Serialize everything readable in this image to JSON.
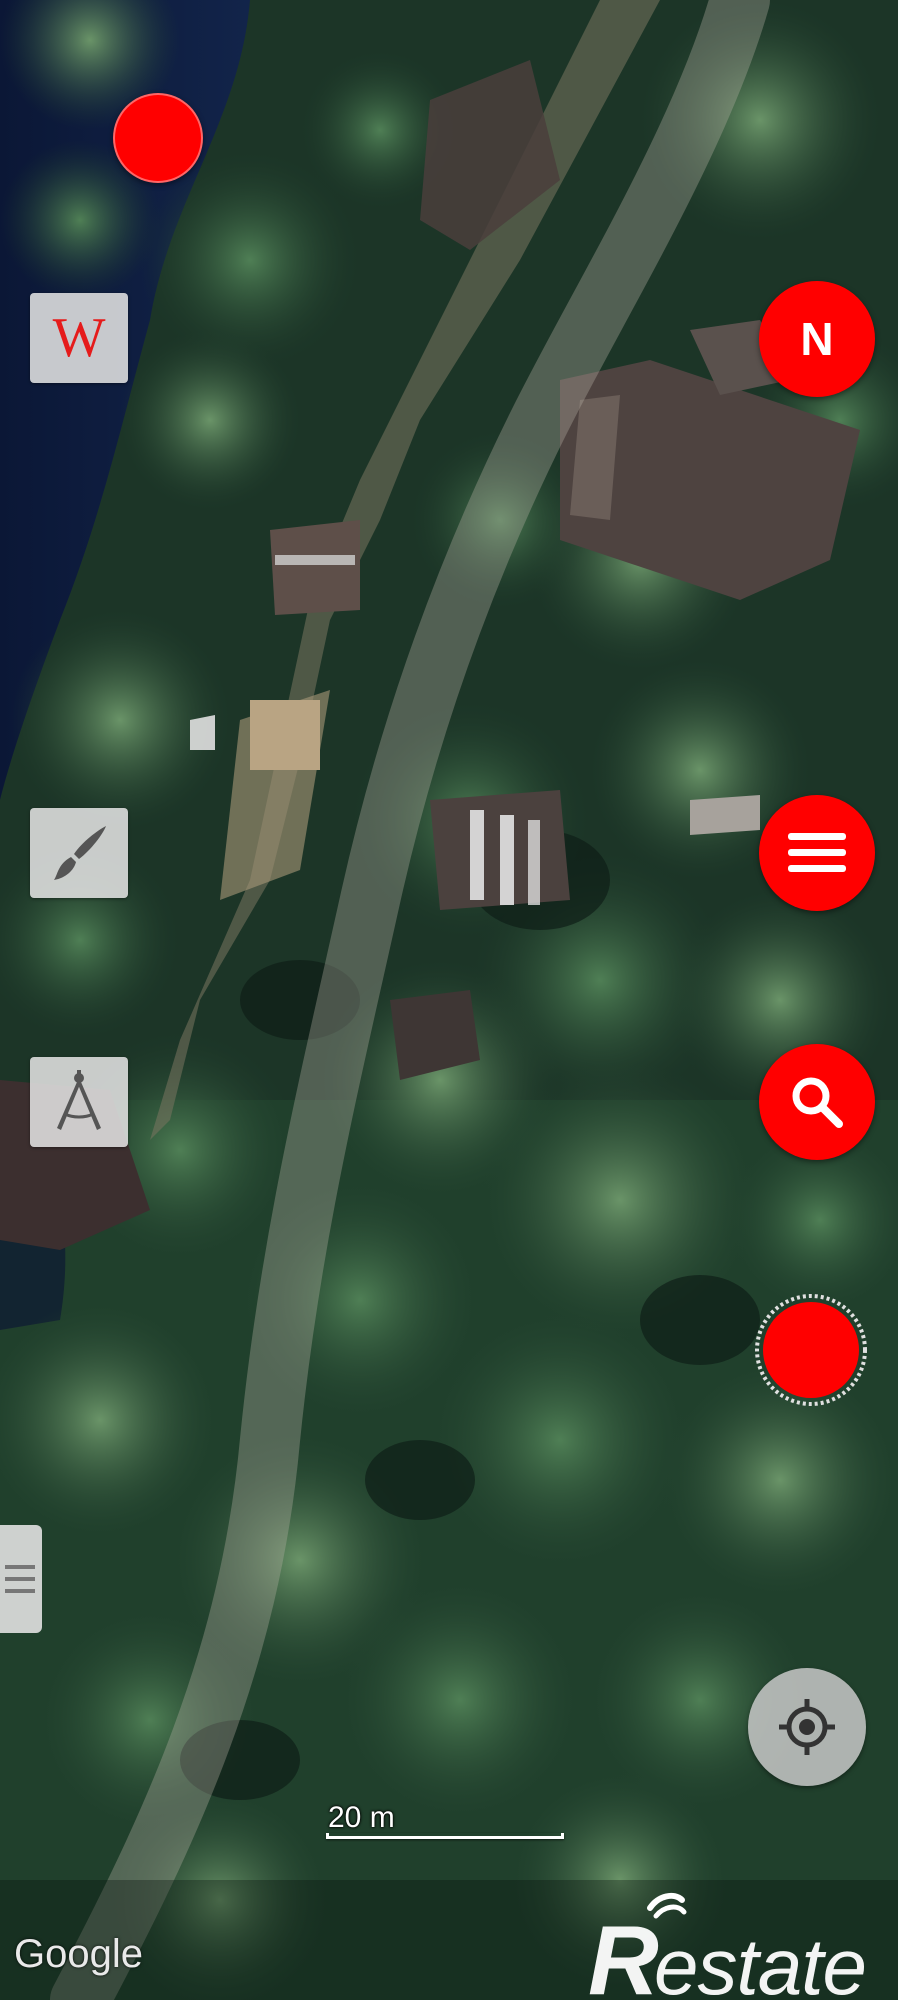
{
  "map": {
    "type": "satellite",
    "attribution": "Google",
    "scale_label": "20 m"
  },
  "controls": {
    "compass_label": "N",
    "wiki_label": "W",
    "menu_icon": "hamburger-icon",
    "search_icon": "search-icon",
    "draw_icon": "paintbrush-icon",
    "measure_icon": "drafting-compass-icon",
    "locate_icon": "crosshair-icon",
    "side_tab_icon": "hamburger-icon"
  },
  "watermark": {
    "text": "Restate"
  },
  "colors": {
    "accent": "#ff0000",
    "button_gray": "#e1e1e1",
    "route_overlay": "#b7b2a6"
  }
}
